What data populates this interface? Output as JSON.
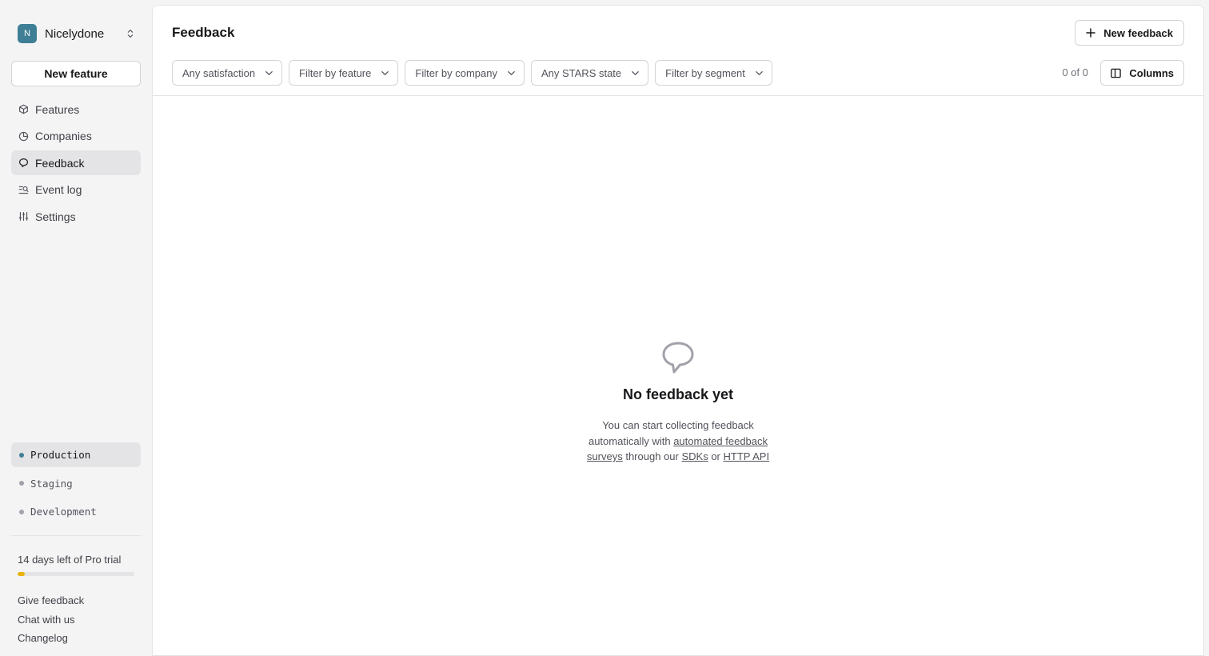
{
  "org": {
    "initial": "N",
    "name": "Nicelydone"
  },
  "sidebar": {
    "new_feature_label": "New feature",
    "items": [
      {
        "label": "Features",
        "icon": "cube-icon"
      },
      {
        "label": "Companies",
        "icon": "pie-chart-icon"
      },
      {
        "label": "Feedback",
        "icon": "chat-bubble-icon",
        "active": true
      },
      {
        "label": "Event log",
        "icon": "search-list-icon"
      },
      {
        "label": "Settings",
        "icon": "sliders-icon"
      }
    ],
    "environments": [
      {
        "label": "Production",
        "active": true
      },
      {
        "label": "Staging"
      },
      {
        "label": "Development"
      }
    ],
    "trial": {
      "text": "14 days left of Pro trial",
      "progress_fraction": 0.06,
      "color": "#eab308"
    },
    "footer_links": [
      "Give feedback",
      "Chat with us",
      "Changelog"
    ]
  },
  "header": {
    "title": "Feedback",
    "new_feedback_label": "New feedback",
    "filters": [
      "Any satisfaction",
      "Filter by feature",
      "Filter by company",
      "Any STARS state",
      "Filter by segment"
    ],
    "count": "0 of 0",
    "columns_label": "Columns"
  },
  "empty_state": {
    "title": "No feedback yet",
    "text_1": "You can start collecting feedback automatically with",
    "link_1": "automated feedback surveys",
    "text_2": "through our",
    "link_2": "SDKs",
    "text_3": "or",
    "link_3": "HTTP API"
  },
  "colors": {
    "accent": "#3f7f96",
    "trial": "#eab308",
    "sidebar_bg": "#f4f4f5"
  }
}
